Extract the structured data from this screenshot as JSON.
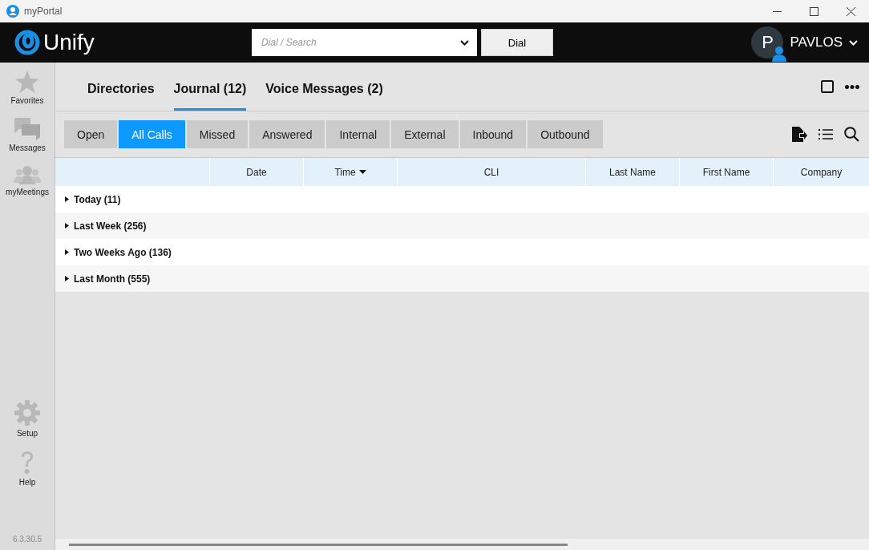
{
  "window": {
    "title": "myPortal"
  },
  "header": {
    "brand": "Unify",
    "dial_field": {
      "placeholder": "Dial / Search"
    },
    "dial_button": "Dial",
    "user": {
      "initial": "P",
      "name": "PAVLOS"
    }
  },
  "sidebar": {
    "items": [
      {
        "label": "Favorites",
        "kind": "star"
      },
      {
        "label": "Messages",
        "kind": "chat"
      },
      {
        "label": "myMeetings",
        "kind": "people"
      }
    ],
    "bottom_items": [
      {
        "label": "Setup",
        "kind": "gear"
      },
      {
        "label": "Help",
        "kind": "help"
      }
    ],
    "version": "6.3.30.5"
  },
  "tabs": [
    {
      "label": "Directories",
      "selected": false
    },
    {
      "label": "Journal (12)",
      "selected": true
    },
    {
      "label": "Voice Messages (2)",
      "selected": false
    }
  ],
  "filters": [
    {
      "label": "Open",
      "selected": false
    },
    {
      "label": "All Calls",
      "selected": true
    },
    {
      "label": "Missed",
      "selected": false
    },
    {
      "label": "Answered",
      "selected": false
    },
    {
      "label": "Internal",
      "selected": false
    },
    {
      "label": "External",
      "selected": false
    },
    {
      "label": "Inbound",
      "selected": false
    },
    {
      "label": "Outbound",
      "selected": false
    }
  ],
  "table": {
    "columns": [
      {
        "label": "Date",
        "sorted": false
      },
      {
        "label": "Time",
        "sorted": true
      },
      {
        "label": "CLI",
        "sorted": false
      },
      {
        "label": "Last Name",
        "sorted": false
      },
      {
        "label": "First Name",
        "sorted": false
      },
      {
        "label": "Company",
        "sorted": false
      }
    ],
    "groups": [
      {
        "label": "Today (11)",
        "expanded": false
      },
      {
        "label": "Last Week (256)",
        "expanded": false
      },
      {
        "label": "Two Weeks Ago (136)",
        "expanded": false
      },
      {
        "label": "Last Month (555)",
        "expanded": false
      }
    ]
  }
}
